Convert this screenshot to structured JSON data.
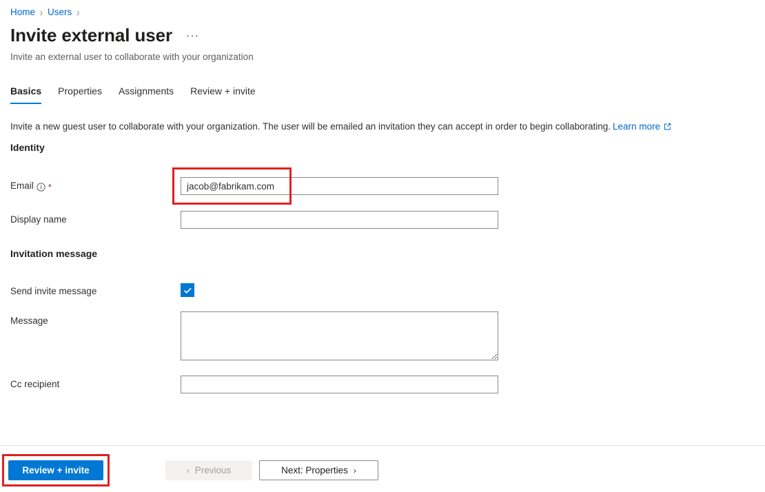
{
  "breadcrumb": {
    "items": [
      {
        "label": "Home"
      },
      {
        "label": "Users"
      }
    ],
    "separator": "›"
  },
  "header": {
    "title": "Invite external user",
    "ellipsis": "···",
    "subtitle": "Invite an external user to collaborate with your organization"
  },
  "tabs": [
    {
      "label": "Basics",
      "active": true
    },
    {
      "label": "Properties",
      "active": false
    },
    {
      "label": "Assignments",
      "active": false
    },
    {
      "label": "Review + invite",
      "active": false
    }
  ],
  "intro": {
    "text": "Invite a new guest user to collaborate with your organization. The user will be emailed an invitation they can accept in order to begin collaborating.",
    "link_label": "Learn more",
    "link_icon": "external-link-icon"
  },
  "sections": {
    "identity": "Identity",
    "invitation_message": "Invitation message"
  },
  "fields": {
    "email": {
      "label": "Email",
      "info_icon": "info-circle-icon",
      "required_marker": "*",
      "value": "jacob@fabrikam.com",
      "placeholder": ""
    },
    "display_name": {
      "label": "Display name",
      "value": "",
      "placeholder": ""
    },
    "send_invite_message": {
      "label": "Send invite message",
      "checked": true,
      "check_icon": "checkmark-icon"
    },
    "message": {
      "label": "Message",
      "value": "",
      "placeholder": ""
    },
    "cc_recipient": {
      "label": "Cc recipient",
      "value": "",
      "placeholder": ""
    }
  },
  "footer": {
    "submit_label": "Review + invite",
    "previous_label": "Previous",
    "previous_icon": "chevron-left-icon",
    "next_label": "Next: Properties",
    "next_icon": "chevron-right-icon"
  },
  "annotations": [
    {
      "name": "email-field-highlight"
    },
    {
      "name": "review-invite-highlight"
    }
  ],
  "colors": {
    "accent": "#0078d4",
    "link": "#0066cc",
    "required": "#a4262c",
    "annotation": "#e02020"
  }
}
